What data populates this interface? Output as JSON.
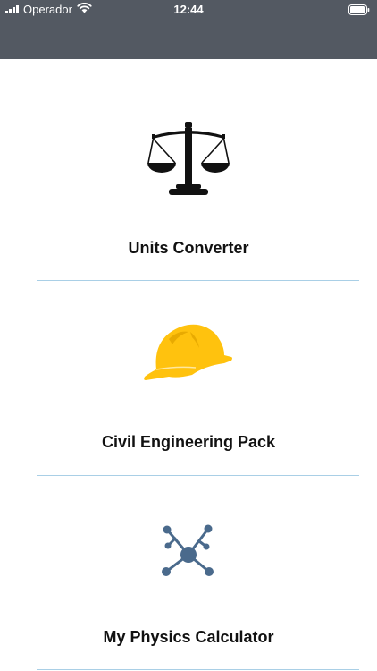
{
  "status_bar": {
    "carrier": "Operador",
    "time": "12:44"
  },
  "menu": {
    "items": [
      {
        "label": "Units Converter",
        "icon": "balance-scale-icon"
      },
      {
        "label": "Civil Engineering Pack",
        "icon": "hard-hat-icon"
      },
      {
        "label": "My Physics Calculator",
        "icon": "network-molecule-icon"
      }
    ]
  },
  "colors": {
    "header": "#535962",
    "divider": "#a9cfe6",
    "hard_hat": "#ffc20e",
    "molecule": "#4a6a8c",
    "scale": "#111111"
  }
}
